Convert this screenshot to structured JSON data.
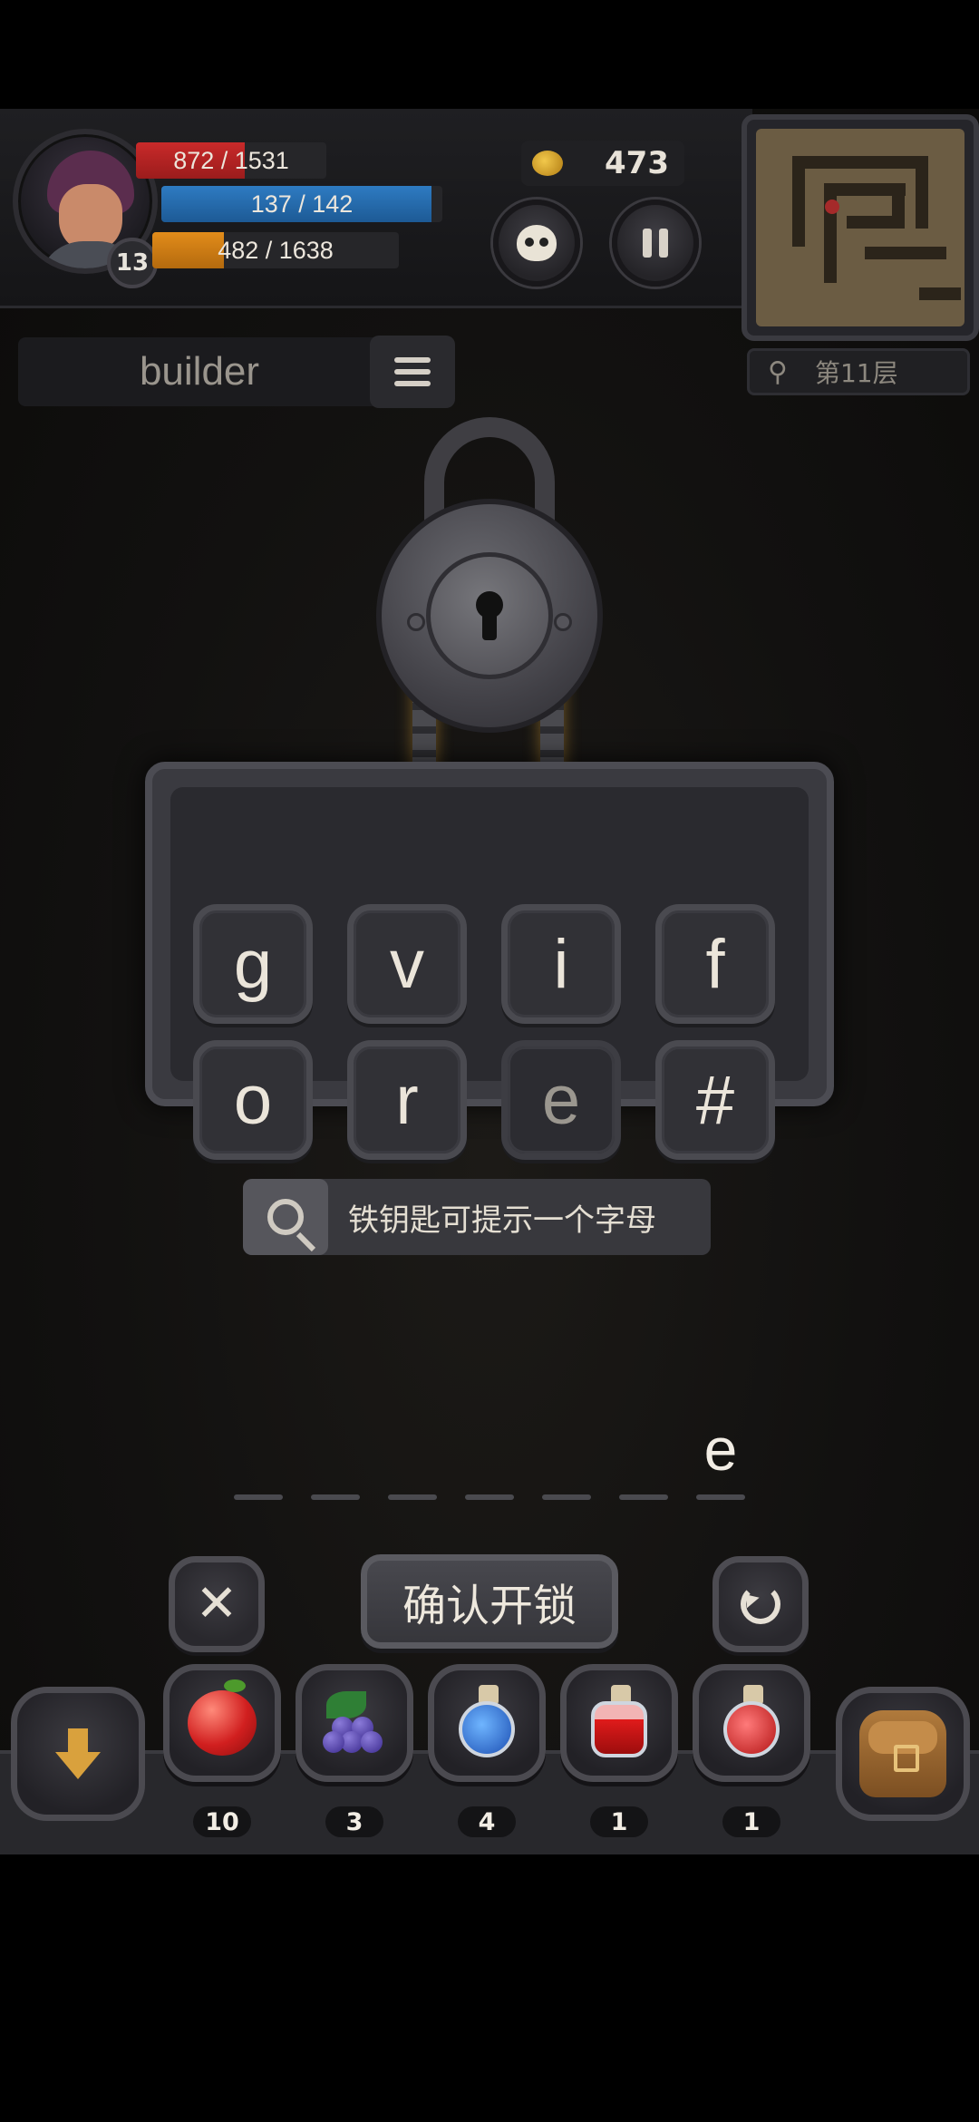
{
  "player": {
    "level": "13",
    "hp": {
      "text": "872 / 1531",
      "fraction": 0.57
    },
    "mp": {
      "text": "137 / 142",
      "fraction": 0.96
    },
    "xp": {
      "text": "482 / 1638",
      "fraction": 0.29
    }
  },
  "gold": "473",
  "floor": "第11层",
  "word_label": "builder",
  "letters": [
    "g",
    "v",
    "i",
    "f",
    "o",
    "r",
    "e",
    "#"
  ],
  "used_letters": [
    "e"
  ],
  "hint_text": "铁钥匙可提示一个字母",
  "answer": {
    "slots": 7,
    "filled": [
      "",
      "",
      "",
      "",
      "",
      "",
      "e"
    ]
  },
  "confirm_label": "确认开锁",
  "items": [
    {
      "name": "apple-icon",
      "count": "10"
    },
    {
      "name": "grape-icon",
      "count": "3"
    },
    {
      "name": "blue-potion-icon",
      "count": "4"
    },
    {
      "name": "red-potion-large-icon",
      "count": "1"
    },
    {
      "name": "red-potion-small-icon",
      "count": "1"
    }
  ],
  "colors": {
    "hp": "#c92a2a",
    "mp": "#2e7bc2",
    "xp": "#e28c1a",
    "gold": "#f2c84b"
  }
}
